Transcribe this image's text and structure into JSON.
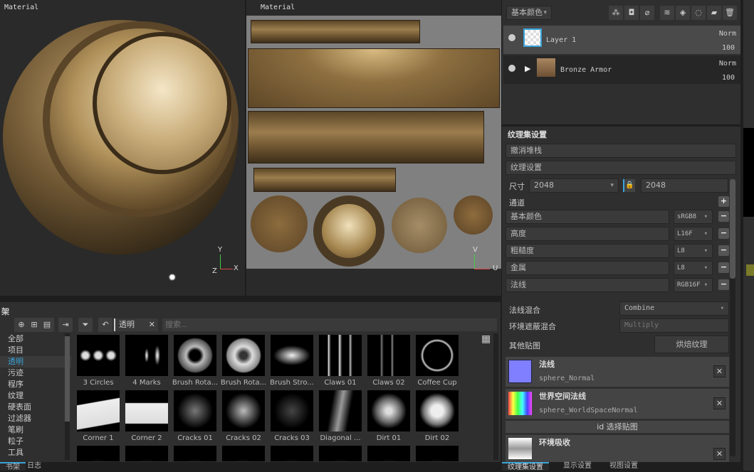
{
  "viewport3d": {
    "label": "Material",
    "axes": {
      "y": "Y",
      "z": "Z",
      "x": "X"
    }
  },
  "viewport2d": {
    "label": "Material",
    "axes": {
      "v": "V",
      "u": "U"
    }
  },
  "layers": {
    "channel_select": "基本颜色",
    "items": [
      {
        "name": "Layer 1",
        "blend": "Norm",
        "opacity": "100",
        "selected": true
      },
      {
        "name": "Bronze Armor",
        "blend": "Norm",
        "opacity": "100",
        "selected": false
      }
    ]
  },
  "texture_set": {
    "title": "纹理集设置",
    "undo_stack": "撤消堆栈",
    "texture_settings": "纹理设置",
    "size_label": "尺寸",
    "size": "2048",
    "size2": "2048",
    "channels_label": "通道",
    "channels": [
      {
        "name": "基本颜色",
        "format": "sRGB8"
      },
      {
        "name": "高度",
        "format": "L16F"
      },
      {
        "name": "粗糙度",
        "format": "L8"
      },
      {
        "name": "金属",
        "format": "L8"
      },
      {
        "name": "法线",
        "format": "RGB16F"
      }
    ],
    "normal_mix_label": "法线混合",
    "normal_mix": "Combine",
    "ao_mix_label": "环境遮蔽混合",
    "ao_mix": "Multiply",
    "other_maps_label": "其他贴图",
    "bake_button": "烘焙纹理",
    "maps": [
      {
        "type": "法线",
        "file": "sphere_Normal"
      },
      {
        "type": "世界空间法线",
        "file": "sphere_WorldSpaceNormal"
      }
    ],
    "id_select": "id 选择贴图",
    "ao_map": "环境吸收"
  },
  "right_tabs": [
    "纹理集设置",
    "显示设置",
    "视图设置"
  ],
  "shelf": {
    "title": "架",
    "filter_tag": "透明",
    "search_placeholder": "搜索...",
    "categories": [
      "全部",
      "项目",
      "透明",
      "污迹",
      "程序",
      "纹理",
      "硬表面",
      "过滤器",
      "笔刷",
      "粒子",
      "工具"
    ],
    "active_category": "透明",
    "items": [
      "3 Circles",
      "4 Marks",
      "Brush Rota...",
      "Brush Rota...",
      "Brush Stro...",
      "Claws 01",
      "Claws 02",
      "Coffee Cup",
      "Corner 1",
      "Corner 2",
      "Cracks 01",
      "Cracks 02",
      "Cracks 03",
      "Diagonal ...",
      "Dirt 01",
      "Dirt 02"
    ]
  },
  "bottom_tabs": [
    "书架",
    "日志"
  ],
  "colors": {
    "accent": "#3aa3d8",
    "normal_map": "#7f7fff",
    "bronze": "#9b7d4e"
  }
}
